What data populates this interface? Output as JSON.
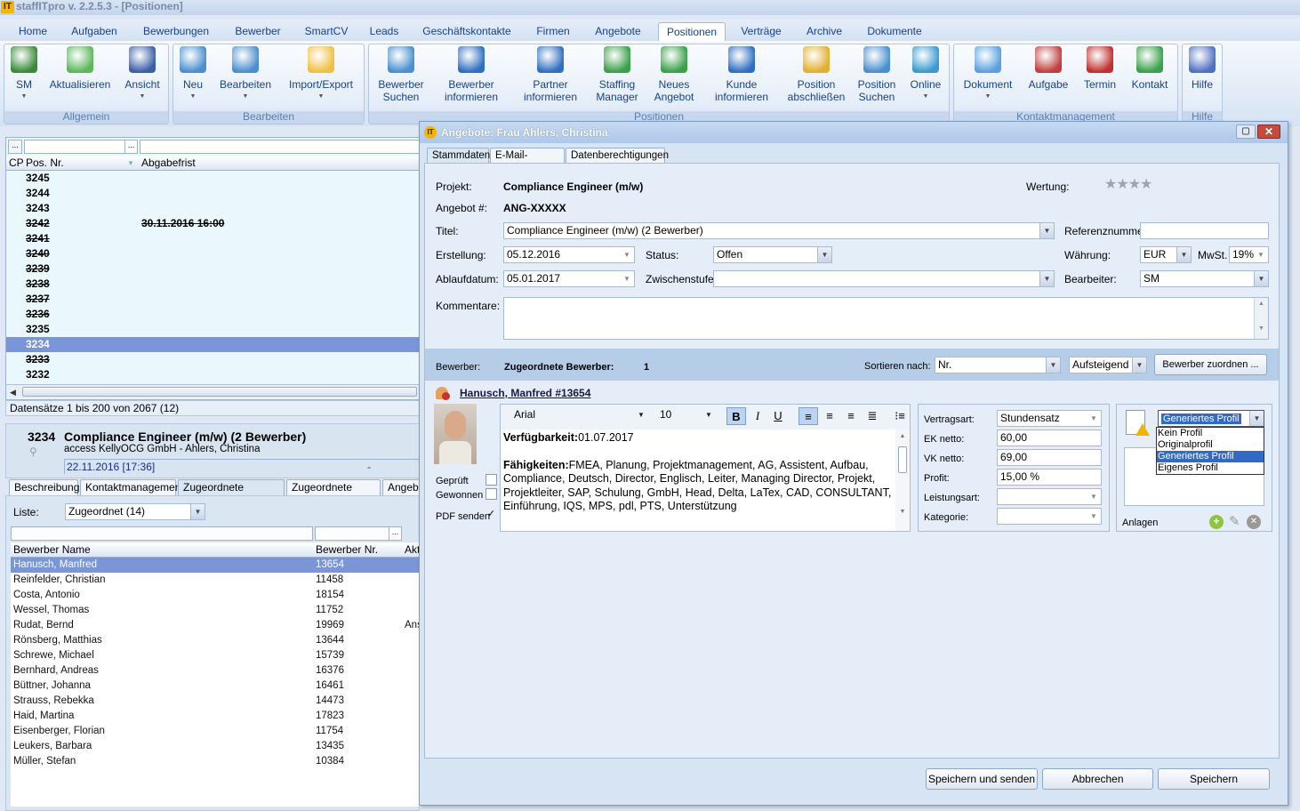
{
  "app": {
    "title": "staffITpro v. 2.2.5.3 - [Positionen]",
    "logo": "IT"
  },
  "menu": [
    {
      "label": "Home"
    },
    {
      "label": "Aufgaben"
    },
    {
      "label": "Bewerbungen"
    },
    {
      "label": "Bewerber"
    },
    {
      "label": "SmartCV"
    },
    {
      "label": "Leads"
    },
    {
      "label": "Geschäftskontakte"
    },
    {
      "label": "Firmen"
    },
    {
      "label": "Angebote"
    },
    {
      "label": "Positionen",
      "active": true
    },
    {
      "label": "Verträge"
    },
    {
      "label": "Archive"
    },
    {
      "label": "Dokumente"
    }
  ],
  "ribbon": {
    "groups": [
      {
        "label": "Allgemein"
      },
      {
        "label": "Bearbeiten"
      },
      {
        "label": "Positionen"
      },
      {
        "label": "Kontaktmanagement"
      },
      {
        "label": "Hilfe"
      }
    ],
    "buttons": [
      {
        "l1": "SM",
        "l2": "",
        "icon": "user-icon",
        "color": "#3a8a3a"
      },
      {
        "l1": "Aktualisieren",
        "l2": "",
        "icon": "refresh-icon",
        "color": "#5cb85c"
      },
      {
        "l1": "Ansicht",
        "l2": "",
        "icon": "view-settings-icon",
        "color": "#3b5fa8"
      },
      {
        "l1": "Neu",
        "l2": "",
        "icon": "new-card-icon",
        "color": "#4a8fd0"
      },
      {
        "l1": "Bearbeiten",
        "l2": "",
        "icon": "edit-card-icon",
        "color": "#4a8fd0"
      },
      {
        "l1": "Import/Export",
        "l2": "",
        "icon": "folder-icon",
        "color": "#f0c040"
      },
      {
        "l1": "Bewerber",
        "l2": "Suchen",
        "icon": "search-card-icon",
        "color": "#4a8fd0"
      },
      {
        "l1": "Bewerber",
        "l2": "informieren",
        "icon": "info-user-icon",
        "color": "#2f6fc0"
      },
      {
        "l1": "Partner",
        "l2": "informieren",
        "icon": "info-users-icon",
        "color": "#2f6fc0"
      },
      {
        "l1": "Staffing",
        "l2": "Manager",
        "icon": "staffing-icon",
        "color": "#3aa04a"
      },
      {
        "l1": "Neues",
        "l2": "Angebot",
        "icon": "new-offer-icon",
        "color": "#3aa04a"
      },
      {
        "l1": "Kunde",
        "l2": "informieren",
        "icon": "info-customer-icon",
        "color": "#2f6fc0"
      },
      {
        "l1": "Position",
        "l2": "abschließen",
        "icon": "lock-folder-icon",
        "color": "#e0b030"
      },
      {
        "l1": "Position",
        "l2": "Suchen",
        "icon": "search-position-icon",
        "color": "#4a8fd0"
      },
      {
        "l1": "Online",
        "l2": "",
        "icon": "globe-icon",
        "color": "#3a9ad0"
      },
      {
        "l1": "Dokument",
        "l2": "",
        "icon": "document-icon",
        "color": "#5aa0e0"
      },
      {
        "l1": "Aufgabe",
        "l2": "",
        "icon": "task-icon",
        "color": "#c04040"
      },
      {
        "l1": "Termin",
        "l2": "",
        "icon": "calendar-icon",
        "color": "#c03030"
      },
      {
        "l1": "Kontakt",
        "l2": "",
        "icon": "contact-icon",
        "color": "#3aa04a"
      },
      {
        "l1": "Hilfe",
        "l2": "",
        "icon": "help-icon",
        "color": "#5070c0"
      }
    ]
  },
  "positions": {
    "columns": {
      "cp": "CP",
      "pos": "Pos. Nr.",
      "deadline": "Abgabefrist"
    },
    "rows": [
      {
        "nr": "3245"
      },
      {
        "nr": "3244"
      },
      {
        "nr": "3243"
      },
      {
        "nr": "3242",
        "struck": true,
        "deadline": "30.11.2016 16:00"
      },
      {
        "nr": "3241",
        "struck": true
      },
      {
        "nr": "3240",
        "struck": true
      },
      {
        "nr": "3239",
        "struck": true
      },
      {
        "nr": "3238",
        "struck": true
      },
      {
        "nr": "3237",
        "struck": true
      },
      {
        "nr": "3236",
        "struck": true
      },
      {
        "nr": "3235"
      },
      {
        "nr": "3234",
        "selected": true
      },
      {
        "nr": "3233",
        "struck": true
      },
      {
        "nr": "3232"
      }
    ],
    "status": "Datensätze 1 bis 200 von 2067 (12)"
  },
  "detail": {
    "nr": "3234",
    "title": "Compliance Engineer (m/w) (2 Bewerber)",
    "company": "access KellyOCG GmbH - Ahlers, Christina",
    "date": "22.11.2016 [17:36]",
    "dash": "-",
    "tabs": [
      "Beschreibung",
      "Kontaktmanagement",
      "Zugeordnete Bewerber",
      "Zugeordnete Partner",
      "Angebo"
    ],
    "liste_label": "Liste:",
    "liste_value": "Zugeordnet (14)",
    "columns": {
      "name": "Bewerber Name",
      "nr": "Bewerber Nr.",
      "akt": "Akt"
    },
    "rows": [
      {
        "name": "Hanusch, Manfred",
        "nr": "13654",
        "selected": true
      },
      {
        "name": "Reinfelder, Christian",
        "nr": "11458"
      },
      {
        "name": "Costa, Antonio",
        "nr": "18154"
      },
      {
        "name": "Wessel, Thomas",
        "nr": "11752"
      },
      {
        "name": "Rudat, Bernd",
        "nr": "19969",
        "akt": "Ans"
      },
      {
        "name": "Rönsberg, Matthias",
        "nr": "13644"
      },
      {
        "name": "Schrewe, Michael",
        "nr": "15739"
      },
      {
        "name": "Bernhard, Andreas",
        "nr": "16376"
      },
      {
        "name": "Büttner, Johanna",
        "nr": "16461"
      },
      {
        "name": "Strauss, Rebekka",
        "nr": "14473"
      },
      {
        "name": "Haid, Martina",
        "nr": "17823"
      },
      {
        "name": "Eisenberger, Florian",
        "nr": "11754"
      },
      {
        "name": "Leukers, Barbara",
        "nr": "13435"
      },
      {
        "name": "Müller, Stefan",
        "nr": "10384"
      }
    ]
  },
  "dialog": {
    "title": "Angebote: Frau Ahlers, Christina",
    "tabs": [
      "Stammdaten",
      "E-Mail-Angebot",
      "Datenberechtigungen"
    ],
    "projekt_label": "Projekt:",
    "projekt": "Compliance Engineer (m/w)",
    "angebot_label": "Angebot #:",
    "angebot": "ANG-XXXXX",
    "wertung_label": "Wertung:",
    "rating": 0,
    "rating_max": 4,
    "titel_label": "Titel:",
    "titel": "Compliance Engineer (m/w) (2 Bewerber)",
    "referenz_label": "Referenznummer:",
    "referenz": "",
    "erstellung_label": "Erstellung:",
    "erstellung": "05.12.2016",
    "status_label": "Status:",
    "status": "Offen",
    "waehrung_label": "Währung:",
    "waehrung": "EUR",
    "mwst_label": "MwSt.",
    "mwst": "19%",
    "ablauf_label": "Ablaufdatum:",
    "ablauf": "05.01.2017",
    "zwischen_label": "Zwischenstufe:",
    "zwischen": "",
    "bearbeiter_label": "Bearbeiter:",
    "bearbeiter": "SM",
    "kommentare_label": "Kommentare:",
    "kommentare": "",
    "bewerber_label": "Bewerber:",
    "zugeordnete_label": "Zugeordnete Bewerber:",
    "zugeordnete_count": "1",
    "sort_label": "Sortieren nach:",
    "sort": "Nr.",
    "order": "Aufsteigend",
    "assign_button": "Bewerber zuordnen ...",
    "candidate": {
      "name": "Hanusch, Manfred #13654",
      "font": "Arial",
      "size": "10",
      "avail_label": "Verfügbarkeit:",
      "avail": "01.07.2017",
      "skills_label": "Fähigkeiten:",
      "skills": "FMEA, Planung, Projektmanagement, AG, Assistent, Aufbau, Compliance, Deutsch, Director, Englisch, Leiter, Managing Director, Projekt, Projektleiter, SAP, Schulung, GmbH, Head, Delta, LaTex, CAD, CONSULTANT, Einführung, IQS, MPS, pdl, PTS, Unterstützung",
      "geprueft_label": "Geprüft",
      "geprueft": false,
      "gewonnen_label": "Gewonnen",
      "gewonnen": false,
      "pdf_label": "PDF senden",
      "pdf": true,
      "vertragsart_label": "Vertragsart:",
      "vertragsart": "Stundensatz",
      "ek_label": "EK netto:",
      "ek": "60,00",
      "vk_label": "VK netto:",
      "vk": "69,00",
      "profit_label": "Profit:",
      "profit": "15,00 %",
      "leistung_label": "Leistungsart:",
      "leistung": "",
      "kategorie_label": "Kategorie:",
      "kategorie": "",
      "profil": "Generiertes Profil",
      "profil_options": [
        "Kein Profil",
        "Originalprofil",
        "Generiertes Profil",
        "Eigenes Profil"
      ],
      "anlagen_label": "Anlagen"
    },
    "buttons": {
      "send": "Speichern und senden",
      "cancel": "Abbrechen",
      "save": "Speichern"
    }
  },
  "colors": {
    "selection": "#7b95d9",
    "dropdown_selection": "#3169c6",
    "accent": "#15428b"
  }
}
